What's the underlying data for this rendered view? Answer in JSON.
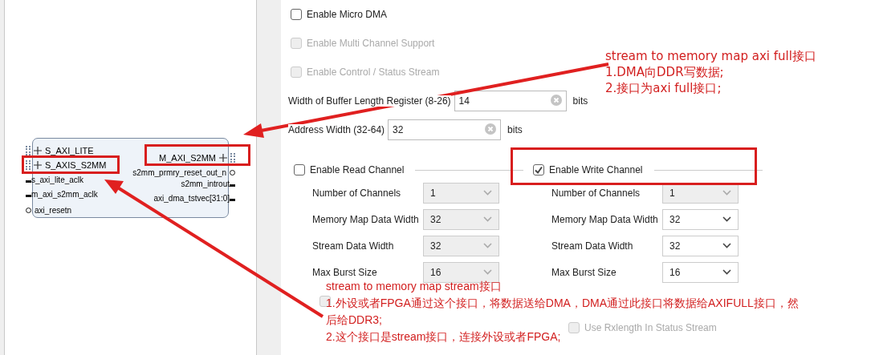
{
  "block": {
    "left_ports": [
      {
        "label": "S_AXI_LITE",
        "kind": "bus"
      },
      {
        "label": "S_AXIS_S2MM",
        "kind": "bus"
      },
      {
        "label": "s_axi_lite_aclk",
        "kind": "pin"
      },
      {
        "label": "m_axi_s2mm_aclk",
        "kind": "pin"
      },
      {
        "label": "axi_resetn",
        "kind": "reset"
      }
    ],
    "right_ports": [
      {
        "label": "M_AXI_S2MM",
        "kind": "bus"
      },
      {
        "label": "s2mm_prmry_reset_out_n",
        "kind": "reset"
      },
      {
        "label": "s2mm_introut",
        "kind": "pin"
      },
      {
        "label": "axi_dma_tstvec[31:0]",
        "kind": "pin"
      }
    ]
  },
  "options": [
    {
      "label": "Enable Micro DMA",
      "checked": false,
      "disabled": false
    },
    {
      "label": "Enable Multi Channel Support",
      "checked": false,
      "disabled": true
    },
    {
      "label": "Enable Control / Status Stream",
      "checked": false,
      "disabled": true
    }
  ],
  "fields": [
    {
      "label": "Width of Buffer Length Register (8-26)",
      "value": "14",
      "unit": "bits"
    },
    {
      "label": "Address Width (32-64)",
      "value": "32",
      "unit": "bits"
    }
  ],
  "channels": [
    {
      "label": "Enable Read Channel",
      "checked": false,
      "params": [
        {
          "label": "Number of Channels",
          "value": "1",
          "disabled": true
        },
        {
          "label": "Memory Map Data Width",
          "value": "32",
          "disabled": true
        },
        {
          "label": "Stream Data Width",
          "value": "32",
          "disabled": true
        },
        {
          "label": "Max Burst Size",
          "value": "16",
          "disabled": true
        }
      ]
    },
    {
      "label": "Enable Write Channel",
      "checked": true,
      "params": [
        {
          "label": "Number of Channels",
          "value": "1",
          "disabled": true
        },
        {
          "label": "Memory Map Data Width",
          "value": "32",
          "disabled": false
        },
        {
          "label": "Stream Data Width",
          "value": "32",
          "disabled": false
        },
        {
          "label": "Max Burst Size",
          "value": "16",
          "disabled": false
        }
      ]
    }
  ],
  "bottom_options": [
    {
      "checked": false,
      "disabled": true
    },
    {
      "label": "Use Rxlength In Status Stream",
      "checked": false,
      "disabled": true
    }
  ],
  "annotations": [
    {
      "lines": [
        "stream to memory map axi full接口",
        "1.DMA向DDR写数据;",
        "2.接口为axi full接口;"
      ]
    },
    {
      "lines": [
        "stream to memory map stream接口",
        "1.外设或者FPGA通过这个接口，将数据送给DMA，DMA通过此接口将数据给AXIFULL接口，然",
        "后给DDR3;",
        "2.这个接口是stream接口，连接外设或者FPGA;"
      ]
    }
  ]
}
